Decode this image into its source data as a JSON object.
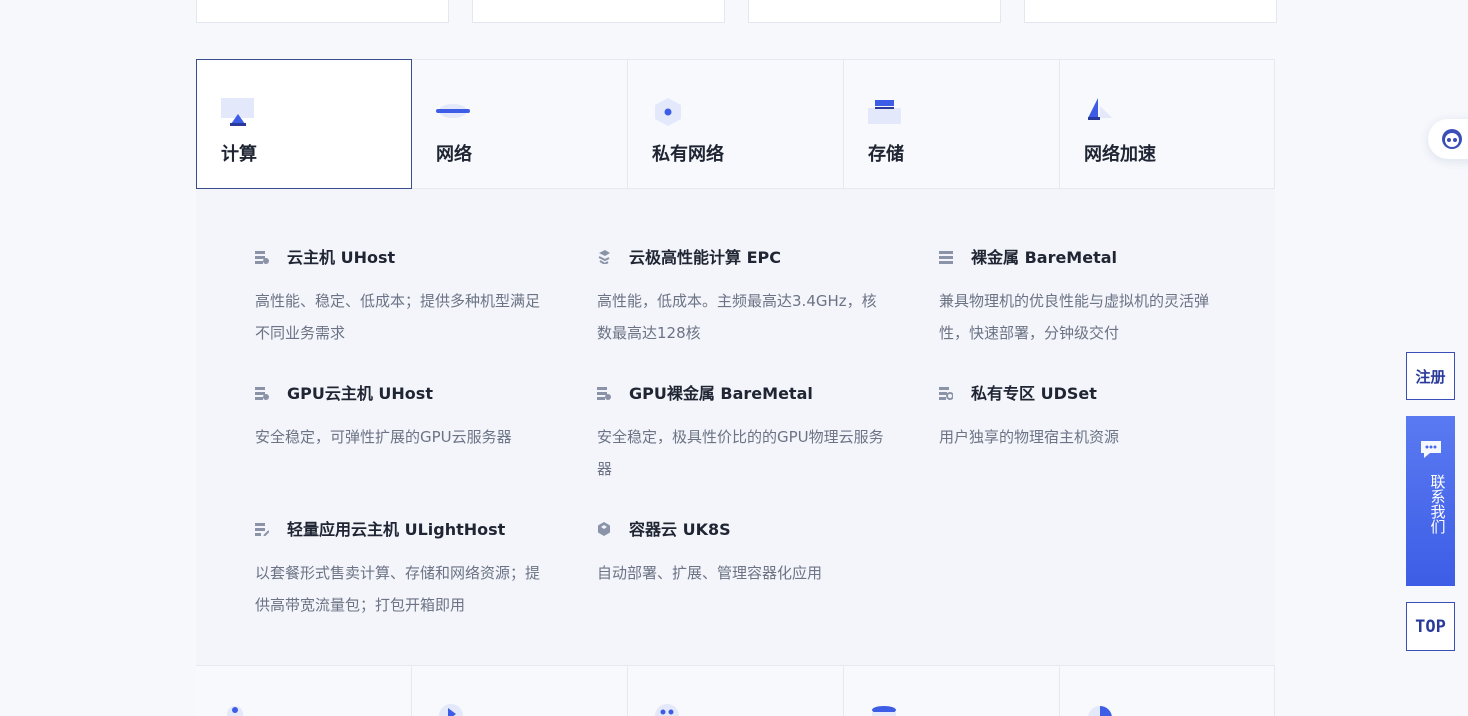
{
  "tabs": [
    {
      "label": "计算",
      "icon": "monitor-icon"
    },
    {
      "label": "网络",
      "icon": "network-icon"
    },
    {
      "label": "私有网络",
      "icon": "hexagon-icon"
    },
    {
      "label": "存储",
      "icon": "storage-icon"
    },
    {
      "label": "网络加速",
      "icon": "acceleration-icon"
    }
  ],
  "active_tab": "计算",
  "products": [
    {
      "title": "云主机 UHost",
      "desc": "高性能、稳定、低成本；提供多种机型满足不同业务需求",
      "icon": "server-icon"
    },
    {
      "title": "云极高性能计算 EPC",
      "desc": "高性能，低成本。主频最高达3.4GHz，核数最高达128核",
      "icon": "layers-icon"
    },
    {
      "title": "裸金属 BareMetal",
      "desc": "兼具物理机的优良性能与虚拟机的灵活弹性，快速部署，分钟级交付",
      "icon": "list-icon"
    },
    {
      "title": "GPU云主机 UHost",
      "desc": "安全稳定，可弹性扩展的GPU云服务器",
      "icon": "server-icon"
    },
    {
      "title": "GPU裸金属 BareMetal",
      "desc": "安全稳定，极具性价比的的GPU物理云服务器",
      "icon": "server-icon"
    },
    {
      "title": "私有专区 UDSet",
      "desc": "用户独享的物理宿主机资源",
      "icon": "private-zone-icon"
    },
    {
      "title": "轻量应用云主机 ULightHost",
      "desc": "以套餐形式售卖计算、存储和网络资源；提供高带宽流量包；打包开箱即用",
      "icon": "light-server-icon"
    },
    {
      "title": "容器云 UK8S",
      "desc": "自动部署、扩展、管理容器化应用",
      "icon": "container-icon"
    }
  ],
  "side": {
    "register": "注册",
    "contact": "联系我们",
    "top": "TOP"
  },
  "colors": {
    "accent": "#3d5de6",
    "active_border": "#3b4d8c",
    "text": "#1f2533",
    "muted": "#6b7385"
  }
}
